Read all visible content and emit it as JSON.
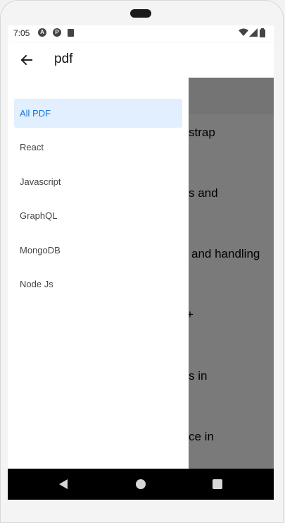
{
  "status": {
    "time": "7:05",
    "icons": [
      "a-icon",
      "p-icon",
      "sd-card-icon",
      "wifi-icon",
      "signal-icon",
      "battery-icon"
    ]
  },
  "appbar": {
    "back_icon": "arrow-left-icon",
    "title": "pdf"
  },
  "drawer": {
    "items": [
      {
        "label": "All PDF",
        "active": true
      },
      {
        "label": "React",
        "active": false
      },
      {
        "label": "Javascript",
        "active": false
      },
      {
        "label": "GraphQL",
        "active": false
      },
      {
        "label": "MongoDB",
        "active": false
      },
      {
        "label": "Node Js",
        "active": false
      }
    ]
  },
  "content": {
    "visible_fragments": [
      "strap",
      "s and",
      "and handling",
      "+",
      "s in",
      "ce in"
    ]
  },
  "colors": {
    "active_bg": "#e1efff",
    "active_text": "#1976d2",
    "scrim": "rgba(0,0,0,0.5)"
  }
}
